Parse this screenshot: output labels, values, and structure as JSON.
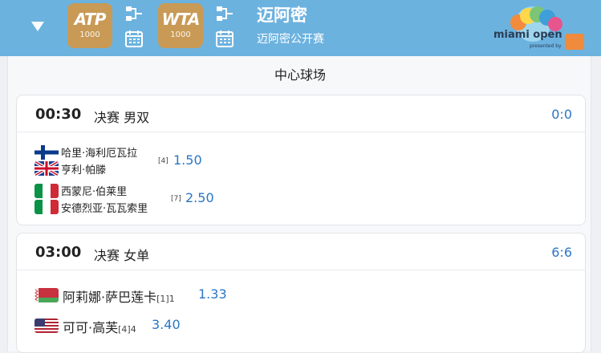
{
  "header": {
    "atp_badge": {
      "main": "ATP",
      "sub": "1000"
    },
    "wta_badge": {
      "main": "WTA",
      "sub": "1000"
    },
    "tournament_title": "迈阿密",
    "tournament_subtitle": "迈阿密公开赛",
    "logo_text": "miami open",
    "logo_presented": "presented by"
  },
  "court": {
    "name": "中心球场"
  },
  "matches": [
    {
      "time": "00:30",
      "round": "决赛 男双",
      "score": "0:0",
      "teams": [
        {
          "players": [
            "哈里·海利厄瓦拉",
            "亨利·帕滕"
          ],
          "seed": "[4]",
          "odds": "1.50"
        },
        {
          "players": [
            "西蒙尼·伯莱里",
            "安德烈亚·瓦瓦索里"
          ],
          "seed": "[7]",
          "odds": "2.50"
        }
      ]
    },
    {
      "time": "03:00",
      "round": "决赛 女单",
      "score": "6:6",
      "players": [
        {
          "name": "阿莉娜·萨巴莲卡",
          "seed": "[1]",
          "set": "1",
          "odds": "1.33"
        },
        {
          "name": "可可·高芙",
          "seed": "[4]",
          "set": "4",
          "odds": "3.40"
        }
      ]
    }
  ],
  "colors": {
    "header_bg": "#6cb2df",
    "accent": "#2b76c6",
    "badge": "#c89a55"
  },
  "icons": [
    "chevron-down-icon",
    "bracket-icon",
    "calendar-icon",
    "miami-open-logo"
  ]
}
